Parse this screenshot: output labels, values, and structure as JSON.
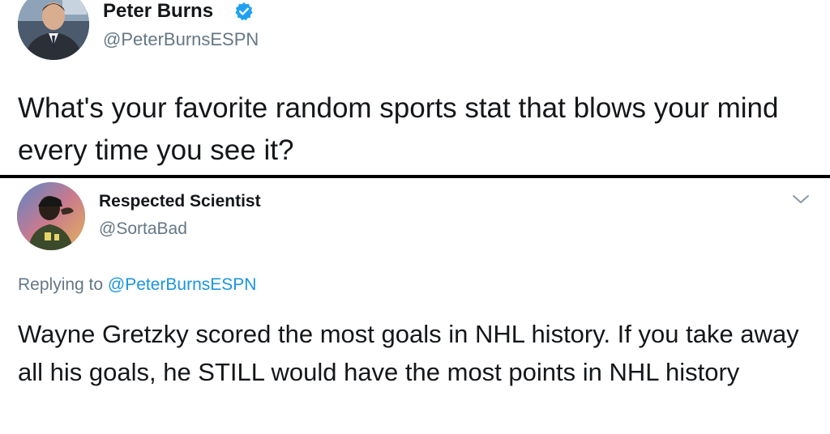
{
  "original_tweet": {
    "author_name": "Peter Burns",
    "author_handle": "@PeterBurnsESPN",
    "verified": true,
    "text": "What's your favorite random sports stat that blows your mind every time you see it?"
  },
  "reply_tweet": {
    "author_name": "Respected Scientist",
    "author_handle": "@SortaBad",
    "replying_prefix": "Replying to",
    "replying_to": "@PeterBurnsESPN",
    "text": "Wayne Gretzky scored the most goals in NHL history. If you take away all his goals, he STILL would have the most points in NHL history",
    "menu_icon": "chevron-down-icon"
  },
  "colors": {
    "text": "#14171a",
    "secondary": "#657786",
    "link": "#1b95e0",
    "verified": "#1da1f2",
    "divider": "#000000"
  }
}
